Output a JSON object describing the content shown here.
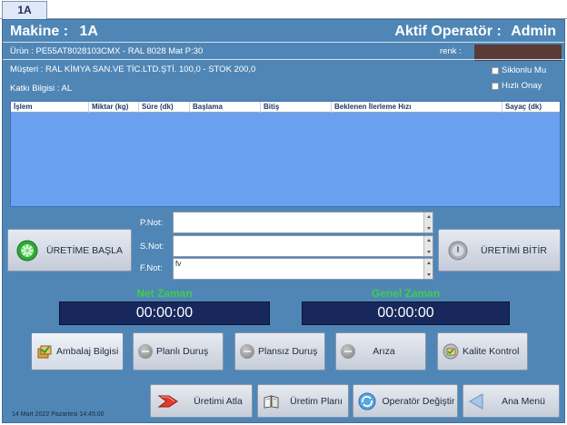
{
  "tab": {
    "label": "1A"
  },
  "header": {
    "machine_label": "Makine :",
    "machine_value": "1A",
    "operator_label": "Aktif Operatör :",
    "operator_value": "Admin"
  },
  "info": {
    "product": "Ürün : PE55AT8028103CMX  -  RAL 8028 Mat P:30",
    "customer": "Müşteri : RAL KİMYA SAN.VE TİC.LTD.ŞTİ. 100,0 - STOK 200,0",
    "additive": "Katkı Bilgisi : AL",
    "color_label": "renk :",
    "color_value": "#5a3b35"
  },
  "checkboxes": {
    "cyclone": "Siklonlu Mu",
    "fast_confirm": "Hızlı Onay"
  },
  "table": {
    "columns": [
      "İşlem",
      "Miktar (kg)",
      "Süre (dk)",
      "Başlama",
      "Bitiş",
      "Beklenen İlerleme Hızı",
      "Sayaç (dk)"
    ]
  },
  "notes": {
    "p_label": "P.Not:",
    "s_label": "S.Not:",
    "f_label": "F.Not:",
    "p_value": "",
    "s_value": "",
    "f_value": "fv"
  },
  "actions": {
    "start": "ÜRETİME BAŞLA",
    "finish": "ÜRETİMİ BİTİR"
  },
  "timers": {
    "net_label": "Net Zaman",
    "net_value": "00:00:00",
    "total_label": "Genel Zaman",
    "total_value": "00:00:00"
  },
  "toolbar": {
    "packaging": "Ambalaj Bilgisi",
    "planned_stop": "Planlı Duruş",
    "unplanned_stop": "Plansız Duruş",
    "fault": "Arıza",
    "quality": "Kalite Kontrol"
  },
  "bottom": {
    "skip": "Üretimi Atla",
    "plan": "Üretim Planı",
    "change_operator": "Operatör Değiştir",
    "main_menu": "Ana Menü"
  },
  "status": {
    "datetime": "14 Mart 2022 Pazartesi 14:45:00"
  },
  "colors": {
    "panel": "#4f86b6",
    "grid": "#6aa0f0",
    "timer_label": "#3ecf4a",
    "timer_box": "#18285c"
  }
}
